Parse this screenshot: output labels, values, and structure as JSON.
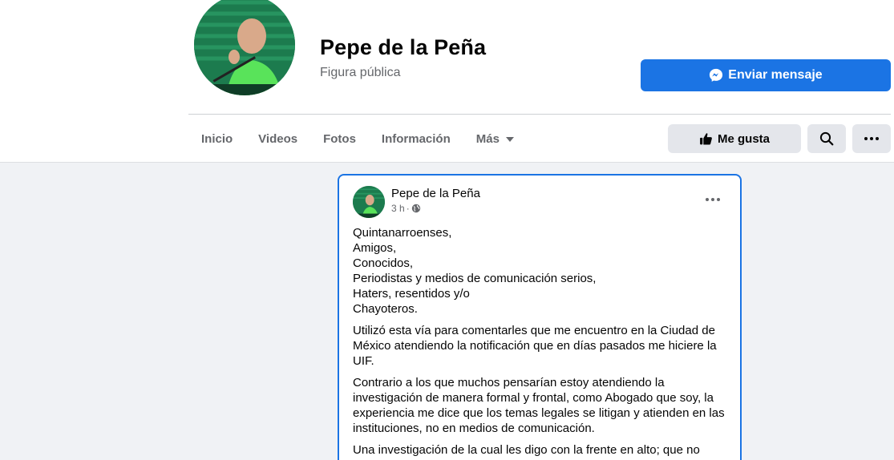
{
  "page": {
    "name": "Pepe de la Peña",
    "category": "Figura pública",
    "message_button": "Enviar mensaje"
  },
  "nav": {
    "items": [
      "Inicio",
      "Videos",
      "Fotos",
      "Información",
      "Más"
    ]
  },
  "actions": {
    "like_label": "Me gusta"
  },
  "post": {
    "author": "Pepe de la Peña",
    "time": "3 h",
    "separator": "·",
    "lines": [
      "Quintanarroenses,",
      "Amigos,",
      "Conocidos,",
      "Periodistas y medios de comunicación serios,",
      "Haters, resentidos y/o",
      "Chayoteros."
    ],
    "paragraph_1": "Utilizó esta vía para comentarles que me encuentro en la Ciudad de México atendiendo la notificación que en días pasados me hiciere la UIF.",
    "paragraph_2": "Contrario a los que muchos pensarían estoy atendiendo la investigación de manera formal y frontal, como Abogado que soy, la experiencia me dice que los temas legales se litigan y atienden en las instituciones, no en medios de comunicación.",
    "paragraph_3": "Una investigación de la cual les digo con la frente en alto; que no"
  },
  "colors": {
    "accent": "#1b74e4",
    "background": "#f0f2f5",
    "button_gray": "#e4e6eb",
    "secondary_text": "#65676b"
  },
  "icons": {
    "message_button": "messenger-icon",
    "like_button": "thumbs-up-icon",
    "search": "search-icon",
    "more": "more-dots-icon",
    "privacy": "globe-icon",
    "nav_more": "caret-down-icon"
  }
}
